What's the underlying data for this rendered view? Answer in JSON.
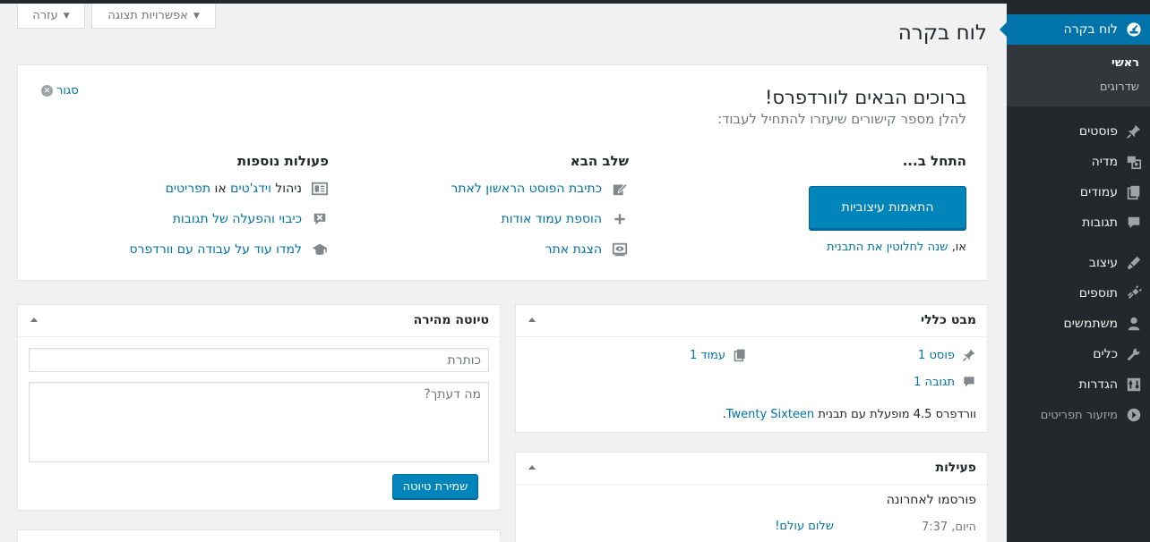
{
  "sidebar": {
    "dashboard": "לוח בקרה",
    "submenu": {
      "home": "ראשי",
      "updates": "שדרוגים"
    },
    "items": [
      {
        "label": "פוסטים",
        "icon": "pin-icon"
      },
      {
        "label": "מדיה",
        "icon": "media-icon"
      },
      {
        "label": "עמודים",
        "icon": "pages-icon"
      },
      {
        "label": "תגובות",
        "icon": "comments-icon"
      },
      {
        "label": "עיצוב",
        "icon": "appearance-icon"
      },
      {
        "label": "תוספים",
        "icon": "plugins-icon"
      },
      {
        "label": "משתמשים",
        "icon": "users-icon"
      },
      {
        "label": "כלים",
        "icon": "tools-icon"
      },
      {
        "label": "הגדרות",
        "icon": "settings-icon"
      }
    ],
    "collapse": "מיזעור תפריטים"
  },
  "screen_meta": {
    "options": "אפשרויות תצוגה",
    "help": "עזרה"
  },
  "page_title": "לוח בקרה",
  "welcome": {
    "title": "ברוכים הבאים לוורדפרס!",
    "about": "להלן מספר קישורים שיעזרו להתחיל לעבוד:",
    "dismiss": "סגור",
    "get_started": {
      "heading": "התחל ב...",
      "button": "התאמות עיצוביות",
      "or_prefix": "או,",
      "or_link": "שנה לחלוטין את התבנית"
    },
    "next_steps": {
      "heading": "שלב הבא",
      "links": [
        "כתיבת הפוסט הראשון לאתר",
        "הוספת עמוד אודות",
        "הצגת אתר"
      ]
    },
    "more_actions": {
      "heading": "פעולות נוספות",
      "widgets_prefix": "ניהול",
      "widgets_link": "וידג'טים",
      "or_word": "או",
      "menus_link": "תפריטים",
      "comments_link": "כיבוי והפעלה של תגובות",
      "learn_link": "למדו עוד על עבודה עם וורדפרס"
    }
  },
  "at_a_glance": {
    "title": "מבט כללי",
    "posts": "פוסט 1",
    "pages": "עמוד 1",
    "comments": "תגובה 1",
    "version_text": "וורדפרס 4.5 מופעלת עם תבנית",
    "theme_link": "Twenty Sixteen",
    "version_suffix": "."
  },
  "activity": {
    "title": "פעילות",
    "recent_heading": "פורסמו לאחרונה",
    "items": [
      {
        "time": "היום, 7:37",
        "title": "שלום עולם!"
      }
    ]
  },
  "quick_draft": {
    "title": "טיוטה מהירה",
    "title_placeholder": "כותרת",
    "content_placeholder": "מה דעתך?",
    "save": "שמירת טיוטה"
  },
  "colors": {
    "accent": "#0073aa",
    "button": "#0085ba",
    "sidebar": "#23282d"
  }
}
